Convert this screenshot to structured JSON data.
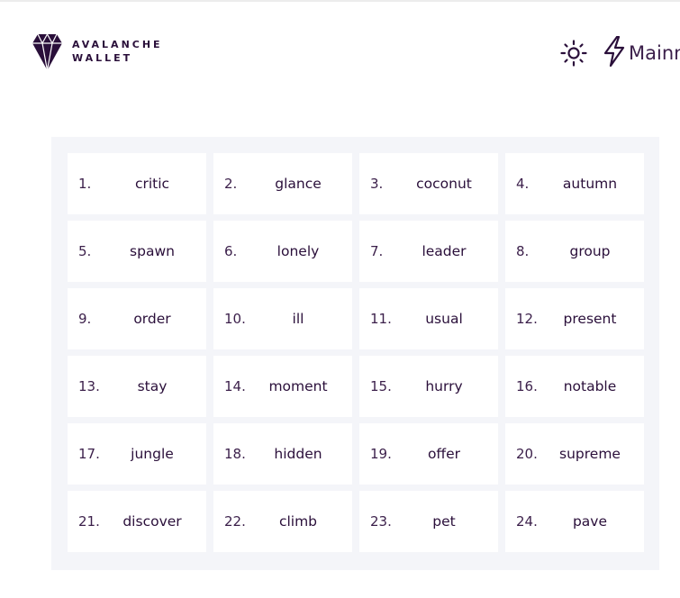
{
  "app": {
    "logo_line1": "AVALANCHE",
    "logo_line2": "WALLET"
  },
  "header": {
    "theme_icon": "sun-icon",
    "network_icon": "lightning-icon",
    "network_label": "Mainnet"
  },
  "mnemonic": {
    "words": [
      {
        "index": "1.",
        "word": "critic"
      },
      {
        "index": "2.",
        "word": "glance"
      },
      {
        "index": "3.",
        "word": "coconut"
      },
      {
        "index": "4.",
        "word": "autumn"
      },
      {
        "index": "5.",
        "word": "spawn"
      },
      {
        "index": "6.",
        "word": "lonely"
      },
      {
        "index": "7.",
        "word": "leader"
      },
      {
        "index": "8.",
        "word": "group"
      },
      {
        "index": "9.",
        "word": "order"
      },
      {
        "index": "10.",
        "word": "ill"
      },
      {
        "index": "11.",
        "word": "usual"
      },
      {
        "index": "12.",
        "word": "present"
      },
      {
        "index": "13.",
        "word": "stay"
      },
      {
        "index": "14.",
        "word": "moment"
      },
      {
        "index": "15.",
        "word": "hurry"
      },
      {
        "index": "16.",
        "word": "notable"
      },
      {
        "index": "17.",
        "word": "jungle"
      },
      {
        "index": "18.",
        "word": "hidden"
      },
      {
        "index": "19.",
        "word": "offer"
      },
      {
        "index": "20.",
        "word": "supreme"
      },
      {
        "index": "21.",
        "word": "discover"
      },
      {
        "index": "22.",
        "word": "climb"
      },
      {
        "index": "23.",
        "word": "pet"
      },
      {
        "index": "24.",
        "word": "pave"
      }
    ]
  },
  "colors": {
    "brand_text": "#2a0f3a",
    "panel_bg": "#f4f5f9",
    "cell_bg": "#ffffff"
  }
}
